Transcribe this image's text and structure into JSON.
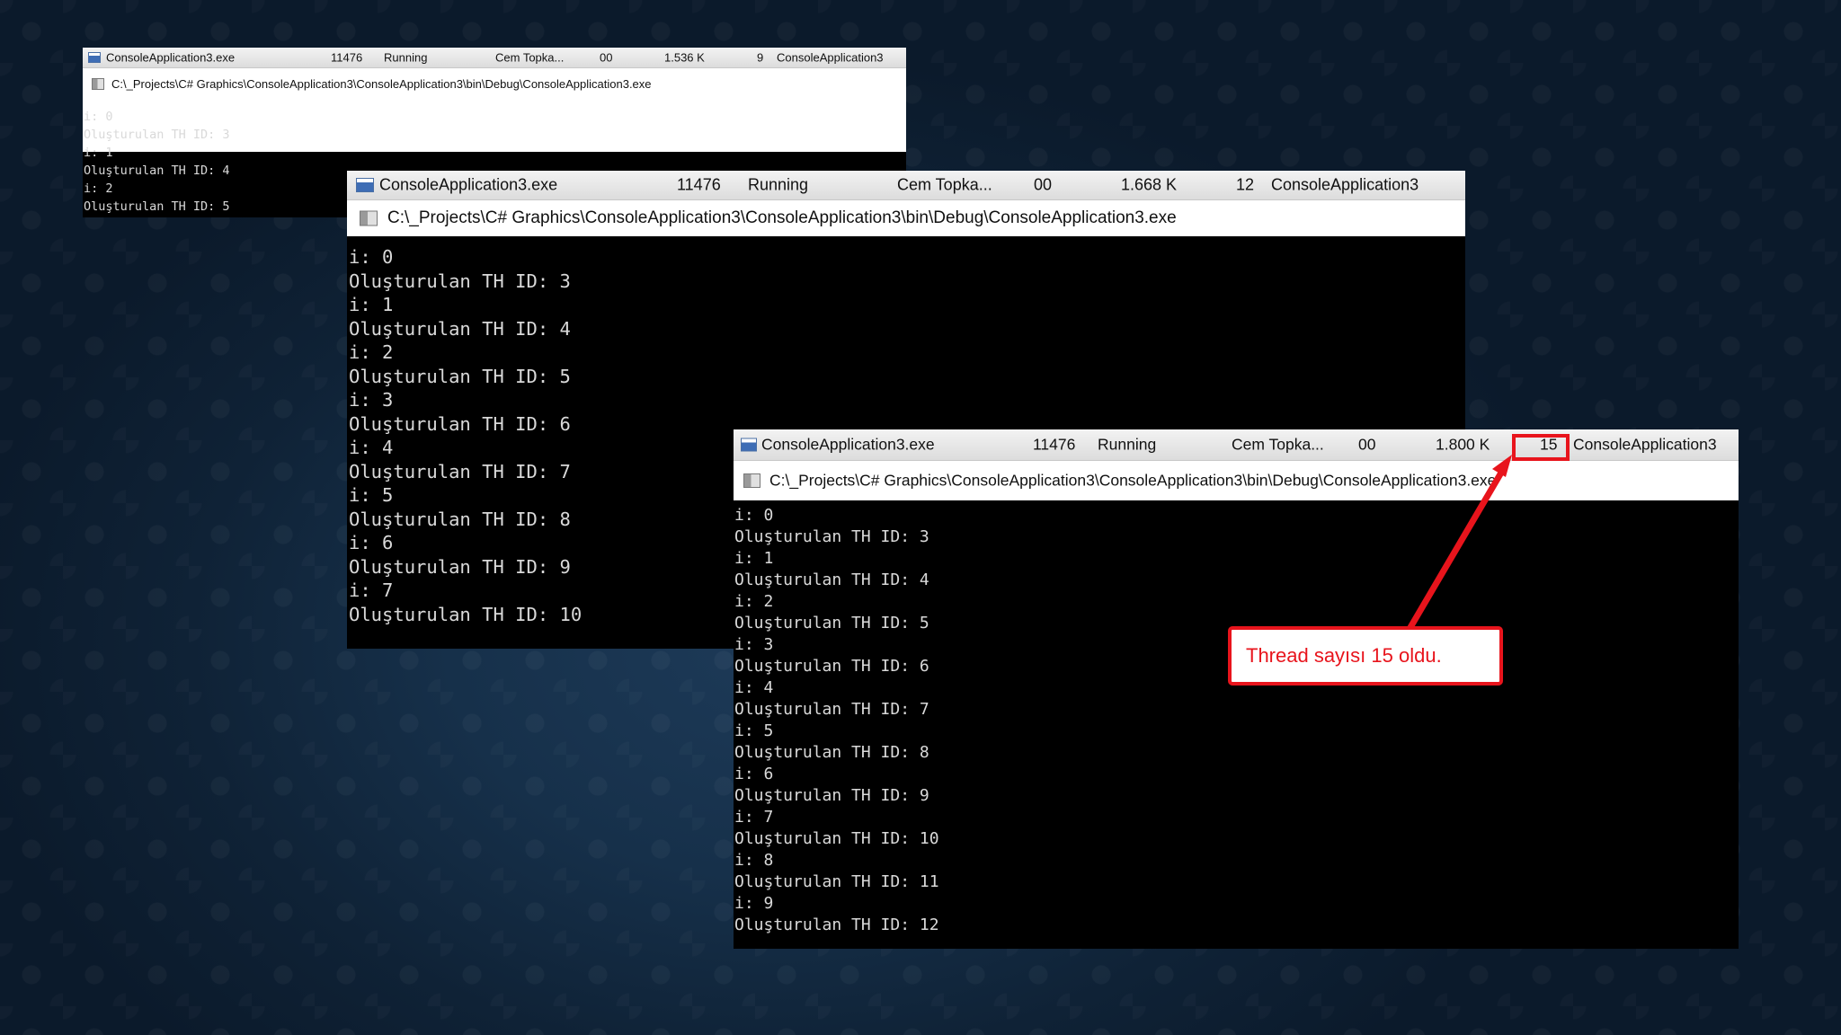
{
  "windows": [
    {
      "process_row": {
        "name": "ConsoleApplication3.exe",
        "pid": "11476",
        "status": "Running",
        "user": "Cem Topka...",
        "cpu": "00",
        "memory": "1.536 K",
        "threads": "9",
        "description": "ConsoleApplication3"
      },
      "path": "C:\\_Projects\\C# Graphics\\ConsoleApplication3\\ConsoleApplication3\\bin\\Debug\\ConsoleApplication3.exe",
      "console_lines": [
        "i: 0",
        "Oluşturulan TH ID: 3",
        "i: 1",
        "Oluşturulan TH ID: 4",
        "i: 2",
        "Oluşturulan TH ID: 5"
      ]
    },
    {
      "process_row": {
        "name": "ConsoleApplication3.exe",
        "pid": "11476",
        "status": "Running",
        "user": "Cem Topka...",
        "cpu": "00",
        "memory": "1.668 K",
        "threads": "12",
        "description": "ConsoleApplication3"
      },
      "path": "C:\\_Projects\\C# Graphics\\ConsoleApplication3\\ConsoleApplication3\\bin\\Debug\\ConsoleApplication3.exe",
      "console_lines": [
        "i: 0",
        "Oluşturulan TH ID: 3",
        "i: 1",
        "Oluşturulan TH ID: 4",
        "i: 2",
        "Oluşturulan TH ID: 5",
        "i: 3",
        "Oluşturulan TH ID: 6",
        "i: 4",
        "Oluşturulan TH ID: 7",
        "i: 5",
        "Oluşturulan TH ID: 8",
        "i: 6",
        "Oluşturulan TH ID: 9",
        "i: 7",
        "Oluşturulan TH ID: 10"
      ]
    },
    {
      "process_row": {
        "name": "ConsoleApplication3.exe",
        "pid": "11476",
        "status": "Running",
        "user": "Cem Topka...",
        "cpu": "00",
        "memory": "1.800 K",
        "threads": "15",
        "description": "ConsoleApplication3"
      },
      "path": "C:\\_Projects\\C# Graphics\\ConsoleApplication3\\ConsoleApplication3\\bin\\Debug\\ConsoleApplication3.exe",
      "console_lines": [
        "i: 0",
        "Oluşturulan TH ID: 3",
        "i: 1",
        "Oluşturulan TH ID: 4",
        "i: 2",
        "Oluşturulan TH ID: 5",
        "i: 3",
        "Oluşturulan TH ID: 6",
        "i: 4",
        "Oluşturulan TH ID: 7",
        "i: 5",
        "Oluşturulan TH ID: 8",
        "i: 6",
        "Oluşturulan TH ID: 9",
        "i: 7",
        "Oluşturulan TH ID: 10",
        "i: 8",
        "Oluşturulan TH ID: 11",
        "i: 9",
        "Oluşturulan TH ID: 12"
      ]
    }
  ],
  "annotation": {
    "callout_text": "Thread sayısı 15 oldu.",
    "accent_color": "#e8141c"
  },
  "icons": {
    "app": "console-app-icon",
    "console": "console-window-icon"
  }
}
